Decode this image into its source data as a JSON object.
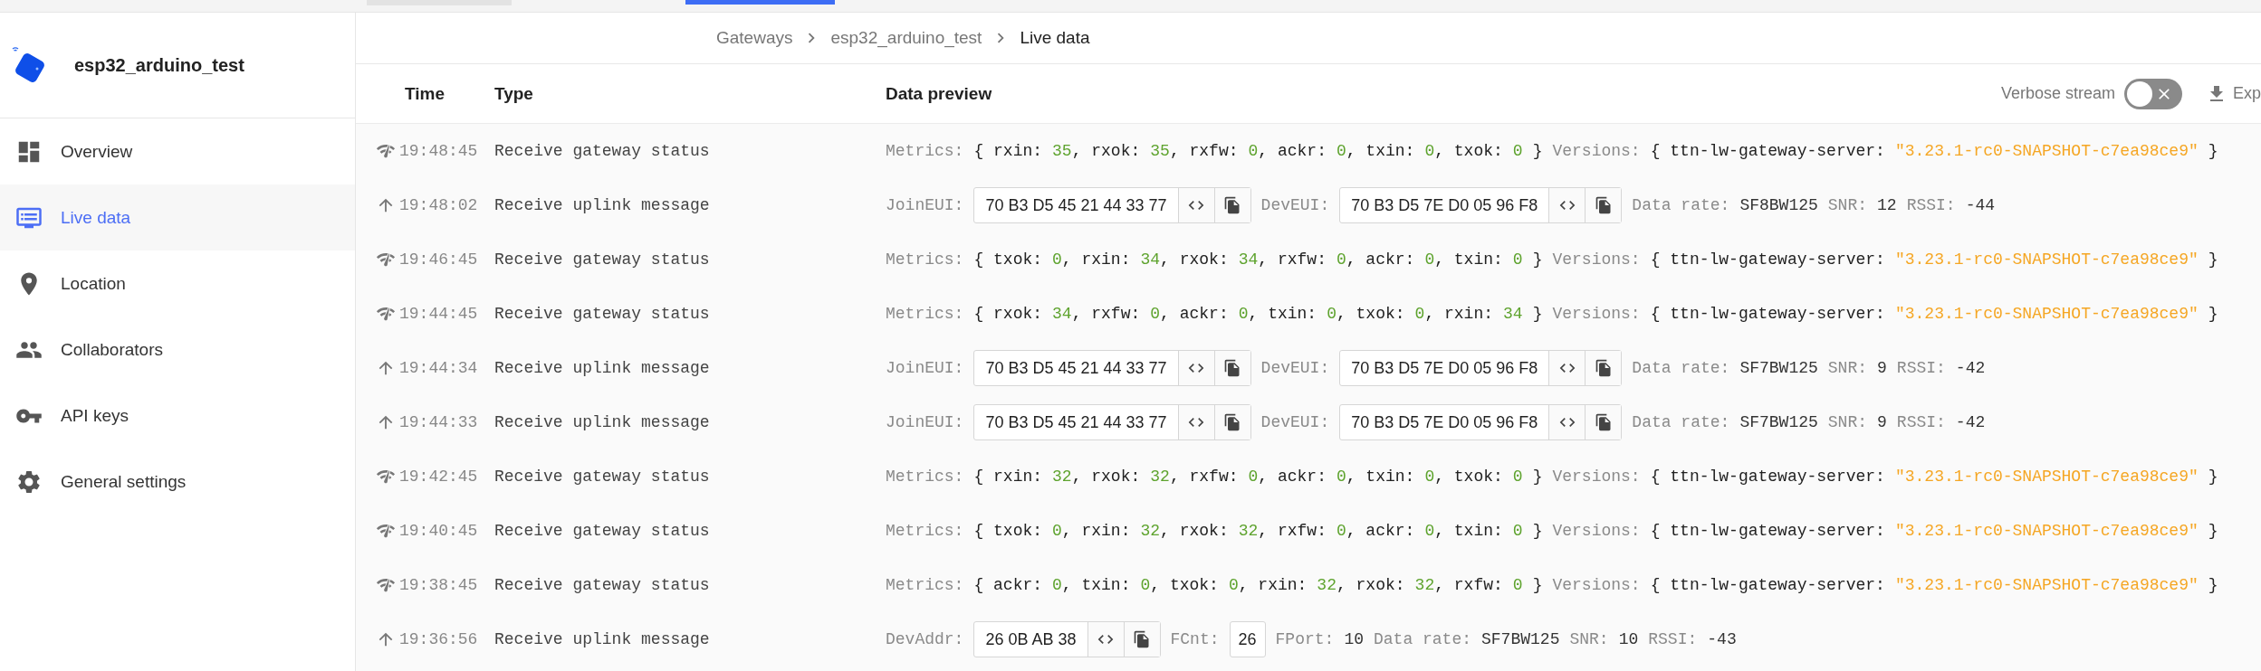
{
  "sidebar": {
    "title": "esp32_arduino_test",
    "items": [
      {
        "label": "Overview",
        "selected": false
      },
      {
        "label": "Live data",
        "selected": true
      },
      {
        "label": "Location",
        "selected": false
      },
      {
        "label": "Collaborators",
        "selected": false
      },
      {
        "label": "API keys",
        "selected": false
      },
      {
        "label": "General settings",
        "selected": false
      }
    ]
  },
  "breadcrumb": [
    "Gateways",
    "esp32_arduino_test",
    "Live data"
  ],
  "table": {
    "columns": [
      "Time",
      "Type",
      "Data preview"
    ],
    "verbose_stream": {
      "label": "Verbose stream",
      "on": false
    },
    "export": "Exp",
    "rows": [
      {
        "kind": "status",
        "time": "19:48:45",
        "type": "Receive gateway status",
        "preview": [
          {
            "kind": "label",
            "text": "Metrics:"
          },
          {
            "kind": "code",
            "text": "{ rxin:"
          },
          {
            "kind": "number",
            "text": "35"
          },
          {
            "kind": "code",
            "text": ", rxok:"
          },
          {
            "kind": "number",
            "text": "35"
          },
          {
            "kind": "code",
            "text": ", rxfw:"
          },
          {
            "kind": "number",
            "text": "0"
          },
          {
            "kind": "code",
            "text": ", ackr:"
          },
          {
            "kind": "number",
            "text": "0"
          },
          {
            "kind": "code",
            "text": ", txin:"
          },
          {
            "kind": "number",
            "text": "0"
          },
          {
            "kind": "code",
            "text": ", txok:"
          },
          {
            "kind": "number",
            "text": "0"
          },
          {
            "kind": "close",
            "text": "}"
          },
          {
            "kind": "label",
            "text": "Versions:"
          },
          {
            "kind": "code",
            "text": "{ ttn-lw-gateway-server:"
          },
          {
            "kind": "string",
            "text": "\"3.23.1-rc0-SNAPSHOT-c7ea98ce9\""
          },
          {
            "kind": "close",
            "text": "}"
          }
        ]
      },
      {
        "kind": "uplink",
        "time": "19:48:02",
        "type": "Receive uplink message",
        "preview": [
          {
            "kind": "label",
            "text": "JoinEUI:"
          },
          {
            "kind": "field",
            "text": "70 B3 D5 45 21 44 33 77"
          },
          {
            "kind": "label",
            "text": "DevEUI:"
          },
          {
            "kind": "field",
            "text": "70 B3 D5 7E D0 05 96 F8"
          },
          {
            "kind": "label",
            "text": "Data rate:"
          },
          {
            "kind": "value",
            "text": "SF8BW125"
          },
          {
            "kind": "label",
            "text": "SNR:"
          },
          {
            "kind": "value",
            "text": "12"
          },
          {
            "kind": "label",
            "text": "RSSI:"
          },
          {
            "kind": "value",
            "text": "-44"
          }
        ]
      },
      {
        "kind": "status",
        "time": "19:46:45",
        "type": "Receive gateway status",
        "preview": [
          {
            "kind": "label",
            "text": "Metrics:"
          },
          {
            "kind": "code",
            "text": "{ txok:"
          },
          {
            "kind": "number",
            "text": "0"
          },
          {
            "kind": "code",
            "text": ", rxin:"
          },
          {
            "kind": "number",
            "text": "34"
          },
          {
            "kind": "code",
            "text": ", rxok:"
          },
          {
            "kind": "number",
            "text": "34"
          },
          {
            "kind": "code",
            "text": ", rxfw:"
          },
          {
            "kind": "number",
            "text": "0"
          },
          {
            "kind": "code",
            "text": ", ackr:"
          },
          {
            "kind": "number",
            "text": "0"
          },
          {
            "kind": "code",
            "text": ", txin:"
          },
          {
            "kind": "number",
            "text": "0"
          },
          {
            "kind": "close",
            "text": "}"
          },
          {
            "kind": "label",
            "text": "Versions:"
          },
          {
            "kind": "code",
            "text": "{ ttn-lw-gateway-server:"
          },
          {
            "kind": "string",
            "text": "\"3.23.1-rc0-SNAPSHOT-c7ea98ce9\""
          },
          {
            "kind": "close",
            "text": "}"
          }
        ]
      },
      {
        "kind": "status",
        "time": "19:44:45",
        "type": "Receive gateway status",
        "preview": [
          {
            "kind": "label",
            "text": "Metrics:"
          },
          {
            "kind": "code",
            "text": "{ rxok:"
          },
          {
            "kind": "number",
            "text": "34"
          },
          {
            "kind": "code",
            "text": ", rxfw:"
          },
          {
            "kind": "number",
            "text": "0"
          },
          {
            "kind": "code",
            "text": ", ackr:"
          },
          {
            "kind": "number",
            "text": "0"
          },
          {
            "kind": "code",
            "text": ", txin:"
          },
          {
            "kind": "number",
            "text": "0"
          },
          {
            "kind": "code",
            "text": ", txok:"
          },
          {
            "kind": "number",
            "text": "0"
          },
          {
            "kind": "code",
            "text": ", rxin:"
          },
          {
            "kind": "number",
            "text": "34"
          },
          {
            "kind": "close",
            "text": "}"
          },
          {
            "kind": "label",
            "text": "Versions:"
          },
          {
            "kind": "code",
            "text": "{ ttn-lw-gateway-server:"
          },
          {
            "kind": "string",
            "text": "\"3.23.1-rc0-SNAPSHOT-c7ea98ce9\""
          },
          {
            "kind": "close",
            "text": "}"
          }
        ]
      },
      {
        "kind": "uplink",
        "time": "19:44:34",
        "type": "Receive uplink message",
        "preview": [
          {
            "kind": "label",
            "text": "JoinEUI:"
          },
          {
            "kind": "field",
            "text": "70 B3 D5 45 21 44 33 77"
          },
          {
            "kind": "label",
            "text": "DevEUI:"
          },
          {
            "kind": "field",
            "text": "70 B3 D5 7E D0 05 96 F8"
          },
          {
            "kind": "label",
            "text": "Data rate:"
          },
          {
            "kind": "value",
            "text": "SF7BW125"
          },
          {
            "kind": "label",
            "text": "SNR:"
          },
          {
            "kind": "value",
            "text": "9"
          },
          {
            "kind": "label",
            "text": "RSSI:"
          },
          {
            "kind": "value",
            "text": "-42"
          }
        ]
      },
      {
        "kind": "uplink",
        "time": "19:44:33",
        "type": "Receive uplink message",
        "preview": [
          {
            "kind": "label",
            "text": "JoinEUI:"
          },
          {
            "kind": "field",
            "text": "70 B3 D5 45 21 44 33 77"
          },
          {
            "kind": "label",
            "text": "DevEUI:"
          },
          {
            "kind": "field",
            "text": "70 B3 D5 7E D0 05 96 F8"
          },
          {
            "kind": "label",
            "text": "Data rate:"
          },
          {
            "kind": "value",
            "text": "SF7BW125"
          },
          {
            "kind": "label",
            "text": "SNR:"
          },
          {
            "kind": "value",
            "text": "9"
          },
          {
            "kind": "label",
            "text": "RSSI:"
          },
          {
            "kind": "value",
            "text": "-42"
          }
        ]
      },
      {
        "kind": "status",
        "time": "19:42:45",
        "type": "Receive gateway status",
        "preview": [
          {
            "kind": "label",
            "text": "Metrics:"
          },
          {
            "kind": "code",
            "text": "{ rxin:"
          },
          {
            "kind": "number",
            "text": "32"
          },
          {
            "kind": "code",
            "text": ", rxok:"
          },
          {
            "kind": "number",
            "text": "32"
          },
          {
            "kind": "code",
            "text": ", rxfw:"
          },
          {
            "kind": "number",
            "text": "0"
          },
          {
            "kind": "code",
            "text": ", ackr:"
          },
          {
            "kind": "number",
            "text": "0"
          },
          {
            "kind": "code",
            "text": ", txin:"
          },
          {
            "kind": "number",
            "text": "0"
          },
          {
            "kind": "code",
            "text": ", txok:"
          },
          {
            "kind": "number",
            "text": "0"
          },
          {
            "kind": "close",
            "text": "}"
          },
          {
            "kind": "label",
            "text": "Versions:"
          },
          {
            "kind": "code",
            "text": "{ ttn-lw-gateway-server:"
          },
          {
            "kind": "string",
            "text": "\"3.23.1-rc0-SNAPSHOT-c7ea98ce9\""
          },
          {
            "kind": "close",
            "text": "}"
          }
        ]
      },
      {
        "kind": "status",
        "time": "19:40:45",
        "type": "Receive gateway status",
        "preview": [
          {
            "kind": "label",
            "text": "Metrics:"
          },
          {
            "kind": "code",
            "text": "{ txok:"
          },
          {
            "kind": "number",
            "text": "0"
          },
          {
            "kind": "code",
            "text": ", rxin:"
          },
          {
            "kind": "number",
            "text": "32"
          },
          {
            "kind": "code",
            "text": ", rxok:"
          },
          {
            "kind": "number",
            "text": "32"
          },
          {
            "kind": "code",
            "text": ", rxfw:"
          },
          {
            "kind": "number",
            "text": "0"
          },
          {
            "kind": "code",
            "text": ", ackr:"
          },
          {
            "kind": "number",
            "text": "0"
          },
          {
            "kind": "code",
            "text": ", txin:"
          },
          {
            "kind": "number",
            "text": "0"
          },
          {
            "kind": "close",
            "text": "}"
          },
          {
            "kind": "label",
            "text": "Versions:"
          },
          {
            "kind": "code",
            "text": "{ ttn-lw-gateway-server:"
          },
          {
            "kind": "string",
            "text": "\"3.23.1-rc0-SNAPSHOT-c7ea98ce9\""
          },
          {
            "kind": "close",
            "text": "}"
          }
        ]
      },
      {
        "kind": "status",
        "time": "19:38:45",
        "type": "Receive gateway status",
        "preview": [
          {
            "kind": "label",
            "text": "Metrics:"
          },
          {
            "kind": "code",
            "text": "{ ackr:"
          },
          {
            "kind": "number",
            "text": "0"
          },
          {
            "kind": "code",
            "text": ", txin:"
          },
          {
            "kind": "number",
            "text": "0"
          },
          {
            "kind": "code",
            "text": ", txok:"
          },
          {
            "kind": "number",
            "text": "0"
          },
          {
            "kind": "code",
            "text": ", rxin:"
          },
          {
            "kind": "number",
            "text": "32"
          },
          {
            "kind": "code",
            "text": ", rxok:"
          },
          {
            "kind": "number",
            "text": "32"
          },
          {
            "kind": "code",
            "text": ", rxfw:"
          },
          {
            "kind": "number",
            "text": "0"
          },
          {
            "kind": "close",
            "text": "}"
          },
          {
            "kind": "label",
            "text": "Versions:"
          },
          {
            "kind": "code",
            "text": "{ ttn-lw-gateway-server:"
          },
          {
            "kind": "string",
            "text": "\"3.23.1-rc0-SNAPSHOT-c7ea98ce9\""
          },
          {
            "kind": "close",
            "text": "}"
          }
        ]
      },
      {
        "kind": "uplink",
        "time": "19:36:56",
        "type": "Receive uplink message",
        "preview": [
          {
            "kind": "label",
            "text": "DevAddr:"
          },
          {
            "kind": "field",
            "text": "26 0B AB 38"
          },
          {
            "kind": "label",
            "text": "FCnt:"
          },
          {
            "kind": "box",
            "text": "26"
          },
          {
            "kind": "label",
            "text": "FPort:"
          },
          {
            "kind": "value",
            "text": "10"
          },
          {
            "kind": "label",
            "text": "Data rate:"
          },
          {
            "kind": "value",
            "text": "SF7BW125"
          },
          {
            "kind": "label",
            "text": "SNR:"
          },
          {
            "kind": "value",
            "text": "10"
          },
          {
            "kind": "label",
            "text": "RSSI:"
          },
          {
            "kind": "value",
            "text": "-43"
          }
        ]
      }
    ]
  }
}
